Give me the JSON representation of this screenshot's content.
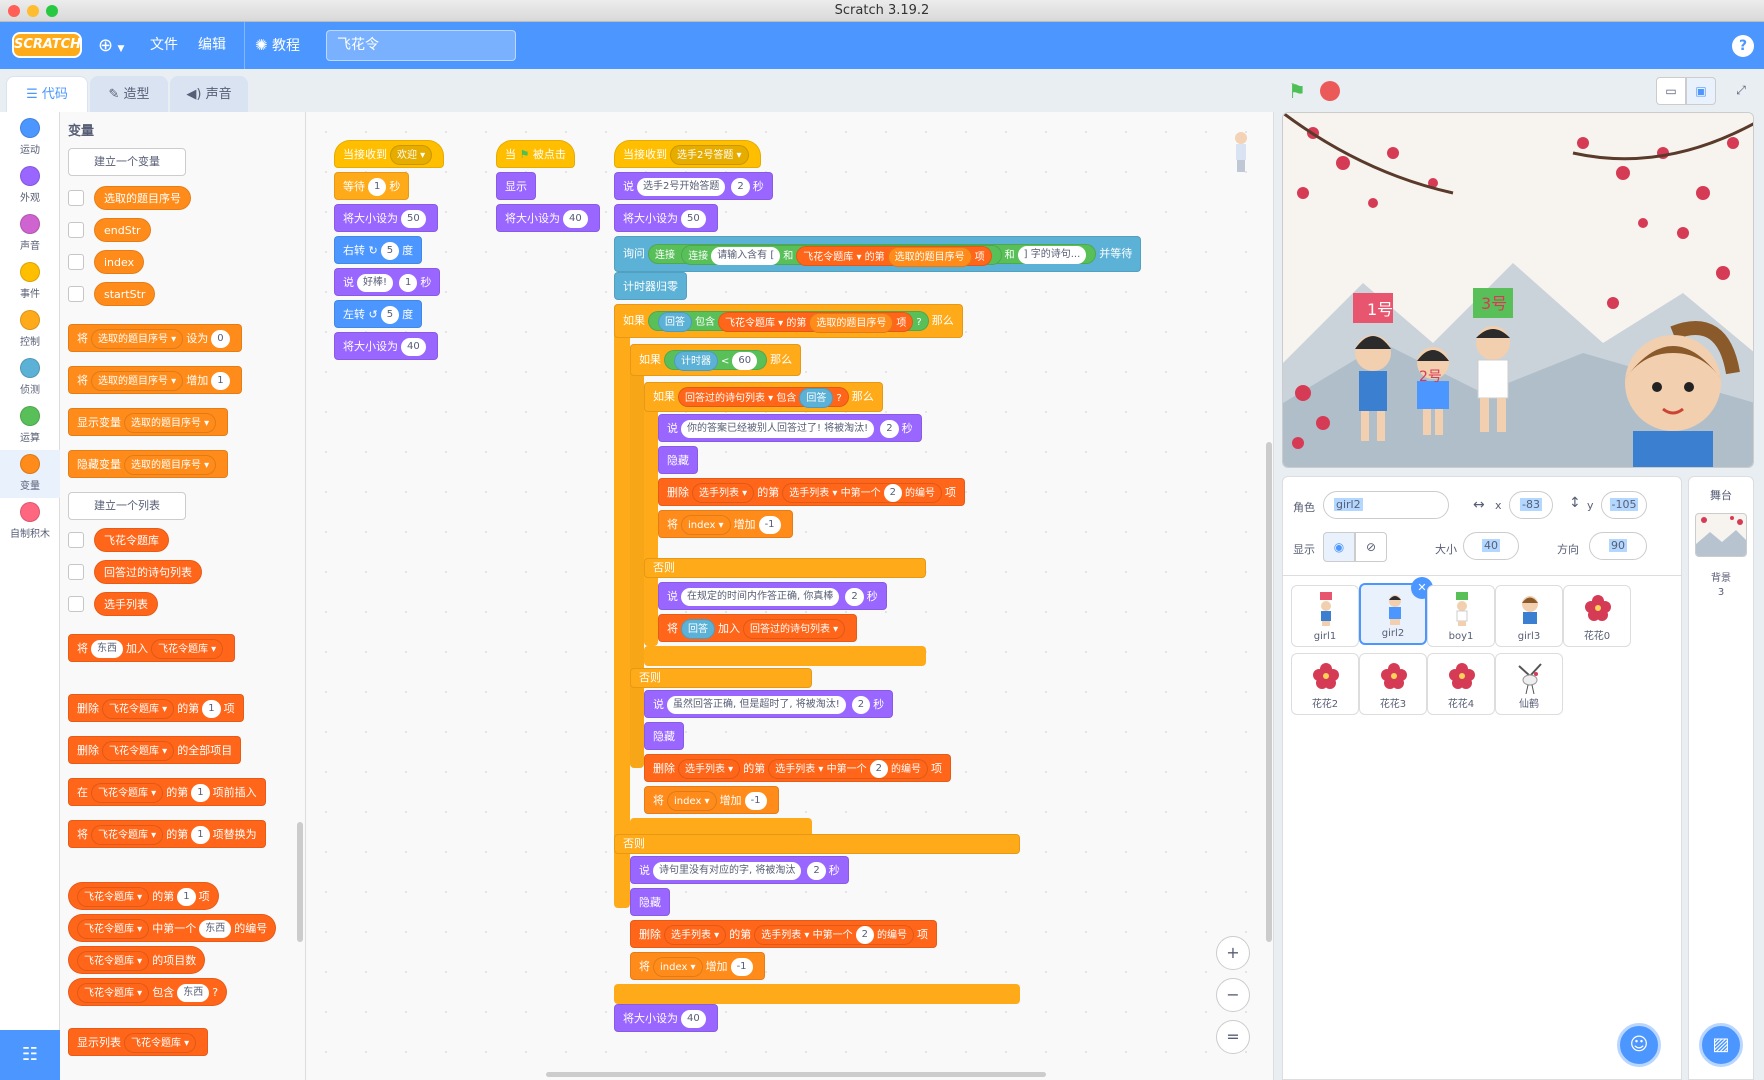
{
  "window": {
    "title": "Scratch 3.19.2"
  },
  "menubar": {
    "logo": "SCRATCH",
    "file": "文件",
    "edit": "编辑",
    "tutorials": "教程",
    "project_title": "飞花令",
    "help": "?"
  },
  "tabs": {
    "code": "代码",
    "costumes": "造型",
    "sounds": "声音"
  },
  "categories": [
    {
      "label": "运动",
      "color": "#4c97ff"
    },
    {
      "label": "外观",
      "color": "#9966ff"
    },
    {
      "label": "声音",
      "color": "#cf63cf"
    },
    {
      "label": "事件",
      "color": "#ffbf00"
    },
    {
      "label": "控制",
      "color": "#ffab19"
    },
    {
      "label": "侦测",
      "color": "#5cb1d6"
    },
    {
      "label": "运算",
      "color": "#59c059"
    },
    {
      "label": "变量",
      "color": "#ff8c1a"
    },
    {
      "label": "自制积木",
      "color": "#ff6680"
    }
  ],
  "palette": {
    "title": "变量",
    "make_var": "建立一个变量",
    "make_list": "建立一个列表",
    "vars": [
      "选取的题目序号",
      "endStr",
      "index",
      "startStr"
    ],
    "set": [
      "将",
      "选取的题目序号",
      "设为",
      "0"
    ],
    "change": [
      "将",
      "选取的题目序号",
      "增加",
      "1"
    ],
    "show_var": [
      "显示变量",
      "选取的题目序号"
    ],
    "hide_var": [
      "隐藏变量",
      "选取的题目序号"
    ],
    "lists": [
      "飞花令题库",
      "回答过的诗句列表",
      "选手列表"
    ],
    "add_list": [
      "将",
      "东西",
      "加入",
      "飞花令题库"
    ],
    "del_item": [
      "删除",
      "飞花令题库",
      "的第",
      "1",
      "项"
    ],
    "del_all": [
      "删除",
      "飞花令题库",
      "的全部项目"
    ],
    "insert": [
      "在",
      "飞花令题库",
      "的第",
      "1",
      "项前插入"
    ],
    "replace": [
      "将",
      "飞花令题库",
      "的第",
      "1",
      "项替换为"
    ],
    "item": [
      "飞花令题库",
      "的第",
      "1",
      "项"
    ],
    "item_index": [
      "飞花令题库",
      "中第一个",
      "东西",
      "的编号"
    ],
    "length": [
      "飞花令题库",
      "的项目数"
    ],
    "contains": [
      "飞花令题库",
      "包含",
      "东西",
      "?"
    ],
    "show_list": [
      "显示列表",
      "飞花令题库"
    ]
  },
  "script1": {
    "hat": [
      "当接收到",
      "欢迎"
    ],
    "wait": [
      "等待",
      "1",
      "秒"
    ],
    "size1": [
      "将大小设为",
      "50"
    ],
    "turn_r": [
      "右转",
      "5",
      "度"
    ],
    "say": [
      "说",
      "好棒!",
      "1",
      "秒"
    ],
    "turn_l": [
      "左转",
      "5",
      "度"
    ],
    "size2": [
      "将大小设为",
      "40"
    ]
  },
  "script2": {
    "hat": [
      "当",
      "被点击"
    ],
    "show": "显示",
    "size": [
      "将大小设为",
      "40"
    ]
  },
  "script3": {
    "hat": [
      "当接收到",
      "选手2号答题"
    ],
    "say1": [
      "说",
      "选手2号开始答题",
      "2",
      "秒"
    ],
    "size1": [
      "将大小设为",
      "50"
    ],
    "ask": [
      "询问",
      "连接",
      "连接",
      "请输入含有 [",
      "和",
      "飞花令题库",
      "的第",
      "选取的题目序号",
      "项",
      "和",
      "] 字的诗句...",
      "并等待"
    ],
    "reset_timer": "计时器归零",
    "if1": [
      "如果",
      "回答",
      "包含",
      "飞花令题库",
      "的第",
      "选取的题目序号",
      "项",
      "?",
      "那么"
    ],
    "if2": [
      "如果",
      "计时器",
      "<",
      "60",
      "那么"
    ],
    "if3": [
      "如果",
      "回答过的诗句列表",
      "包含",
      "回答",
      "?",
      "那么"
    ],
    "say2": [
      "说",
      "你的答案已经被别人回答过了! 将被淘汰!",
      "2",
      "秒"
    ],
    "hide": "隐藏",
    "delete": [
      "删除",
      "选手列表",
      "的第",
      "选手列表",
      "中第一个",
      "2",
      "的编号",
      "项"
    ],
    "change": [
      "将",
      "index",
      "增加",
      "-1"
    ],
    "else": "否则",
    "say3": [
      "说",
      "在规定的时间内作答正确, 你真棒",
      "2",
      "秒"
    ],
    "add": [
      "将",
      "回答",
      "加入",
      "回答过的诗句列表"
    ],
    "say4": [
      "说",
      "虽然回答正确, 但是超时了, 将被淘汰!",
      "2",
      "秒"
    ],
    "say5": [
      "说",
      "诗句里没有对应的字, 将被淘汰",
      "2",
      "秒"
    ],
    "size2": [
      "将大小设为",
      "40"
    ]
  },
  "zoom": {
    "in": "+",
    "out": "−",
    "reset": "="
  },
  "stage_labels": [
    "1号",
    "2号",
    "3号"
  ],
  "sprite_info": {
    "sprite_label": "角色",
    "sprite_name": "girl2",
    "x_label": "x",
    "x": "-83",
    "y_label": "y",
    "y": "-105",
    "show_label": "显示",
    "size_label": "大小",
    "size": "40",
    "dir_label": "方向",
    "dir": "90"
  },
  "sprites": [
    {
      "name": "girl1"
    },
    {
      "name": "girl2",
      "selected": true
    },
    {
      "name": "boy1"
    },
    {
      "name": "girl3"
    },
    {
      "name": "花花0"
    },
    {
      "name": "花花2"
    },
    {
      "name": "花花3"
    },
    {
      "name": "花花4"
    },
    {
      "name": "仙鹤"
    }
  ],
  "stage_pane": {
    "title": "舞台",
    "backdrop_label": "背景",
    "backdrop_count": "3"
  }
}
